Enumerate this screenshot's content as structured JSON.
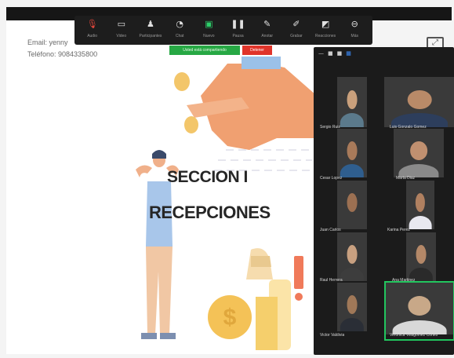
{
  "presenter": {
    "email": "Email: yenny",
    "phone": "Teléfono: 9084335800"
  },
  "slide": {
    "title": "SECCION I",
    "subtitle": "RECEPCIONES"
  },
  "toolbar": {
    "items": [
      {
        "label": "Audio",
        "icon": "microphone-muted-icon"
      },
      {
        "label": "Video",
        "icon": "video-camera-icon"
      },
      {
        "label": "Participantes",
        "icon": "participants-icon"
      },
      {
        "label": "Chat",
        "icon": "chat-icon"
      },
      {
        "label": "Nuevo",
        "icon": "new-share-icon"
      },
      {
        "label": "Pausa",
        "icon": "pause-icon"
      },
      {
        "label": "Anotar",
        "icon": "annotate-icon"
      },
      {
        "label": "Grabar",
        "icon": "record-icon"
      },
      {
        "label": "Reacciones",
        "icon": "reactions-icon"
      },
      {
        "label": "Más",
        "icon": "more-icon"
      }
    ],
    "sharing_status": "Usted está compartiendo",
    "stop_share_label": "Detener"
  },
  "gallery": {
    "header_icons": [
      "minimize-icon",
      "stop-video-icon",
      "speaker-view-icon",
      "gallery-view-icon"
    ],
    "participants": [
      {
        "name": "Sergio Ruiz",
        "skin": "#c9a07c",
        "shirt": "#5b7a8c"
      },
      {
        "name": "Luis Gonzalo Gomez",
        "skin": "#b98a68",
        "shirt": "#2d3e5c"
      },
      {
        "name": "Cesar Lopez",
        "skin": "#a87a5a",
        "shirt": "#2f5e8e"
      },
      {
        "name": "Marta Diaz",
        "skin": "#c09070",
        "shirt": "#8a8a8a"
      },
      {
        "name": "Juan Carlos",
        "skin": "#9c7052",
        "shirt": "#3a3a3a"
      },
      {
        "name": "Karina Perez",
        "skin": "#b08060",
        "shirt": "#e8e8f0"
      },
      {
        "name": "Raul Herrera",
        "skin": "#c8a080",
        "shirt": "#3d3d3d"
      },
      {
        "name": "Ana Martinez",
        "skin": "#b48868",
        "shirt": "#2a2a2a"
      },
      {
        "name": "Victor Valdivia",
        "skin": "#a07858",
        "shirt": "#2a2e36"
      },
      {
        "name": "Veronica Villagomez Cortés",
        "skin": "#c8a888",
        "shirt": "#d8d8d8"
      }
    ],
    "active_speaker": "Veronica Villagomez Cortés"
  },
  "colors": {
    "accent_green": "#2dd06a",
    "stop_red": "#e0342a",
    "slide_title": "#262626",
    "gallery_bg": "#1b1b1b"
  }
}
